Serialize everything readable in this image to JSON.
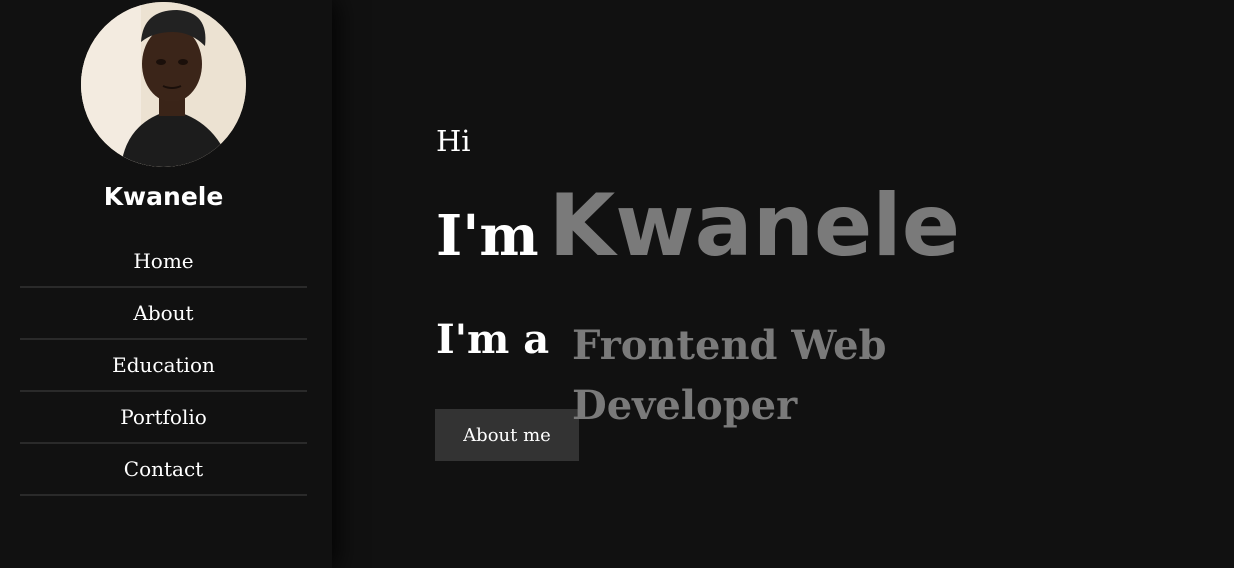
{
  "sidebar": {
    "brand_name": "Kwanele",
    "nav": [
      {
        "label": "Home"
      },
      {
        "label": "About"
      },
      {
        "label": "Education"
      },
      {
        "label": "Portfolio"
      },
      {
        "label": "Contact"
      }
    ]
  },
  "hero": {
    "greeting": "Hi",
    "name_prefix": "I'm",
    "name": "Kwanele",
    "role_prefix": "I'm a",
    "role": "Frontend Web Developer",
    "cta_label": "About me"
  },
  "colors": {
    "background": "#111111",
    "text": "#ffffff",
    "accent_text": "#7a7a7a",
    "button": "#333333",
    "divider": "#2a2a2a"
  }
}
